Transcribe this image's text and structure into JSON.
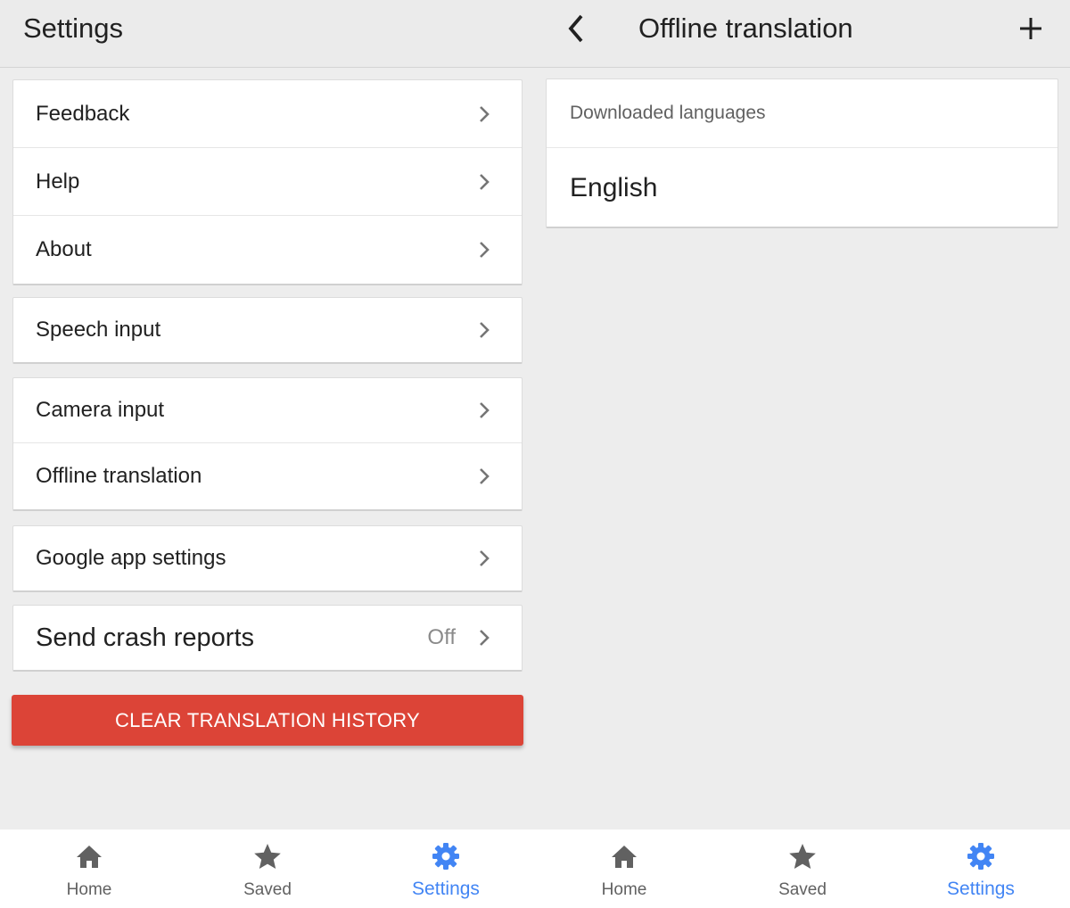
{
  "left": {
    "title": "Settings",
    "groups": [
      {
        "items": [
          {
            "label": "Feedback"
          },
          {
            "label": "Help"
          },
          {
            "label": "About"
          }
        ]
      },
      {
        "items": [
          {
            "label": "Speech input"
          }
        ]
      },
      {
        "items": [
          {
            "label": "Camera input"
          },
          {
            "label": "Offline translation"
          }
        ]
      },
      {
        "items": [
          {
            "label": "Google app settings"
          }
        ]
      },
      {
        "items": [
          {
            "label": "Send crash reports",
            "value": "Off"
          }
        ]
      }
    ],
    "clear_button": "CLEAR TRANSLATION HISTORY"
  },
  "right": {
    "title": "Offline translation",
    "section_header": "Downloaded languages",
    "languages": [
      "English"
    ]
  },
  "tabs": [
    {
      "label": "Home",
      "icon": "home-icon"
    },
    {
      "label": "Saved",
      "icon": "star-icon"
    },
    {
      "label": "Settings",
      "icon": "gear-icon",
      "active": true
    }
  ],
  "colors": {
    "accent": "#4285f4",
    "danger": "#dc4437",
    "background": "#ededed",
    "icon_inactive": "#616161"
  }
}
